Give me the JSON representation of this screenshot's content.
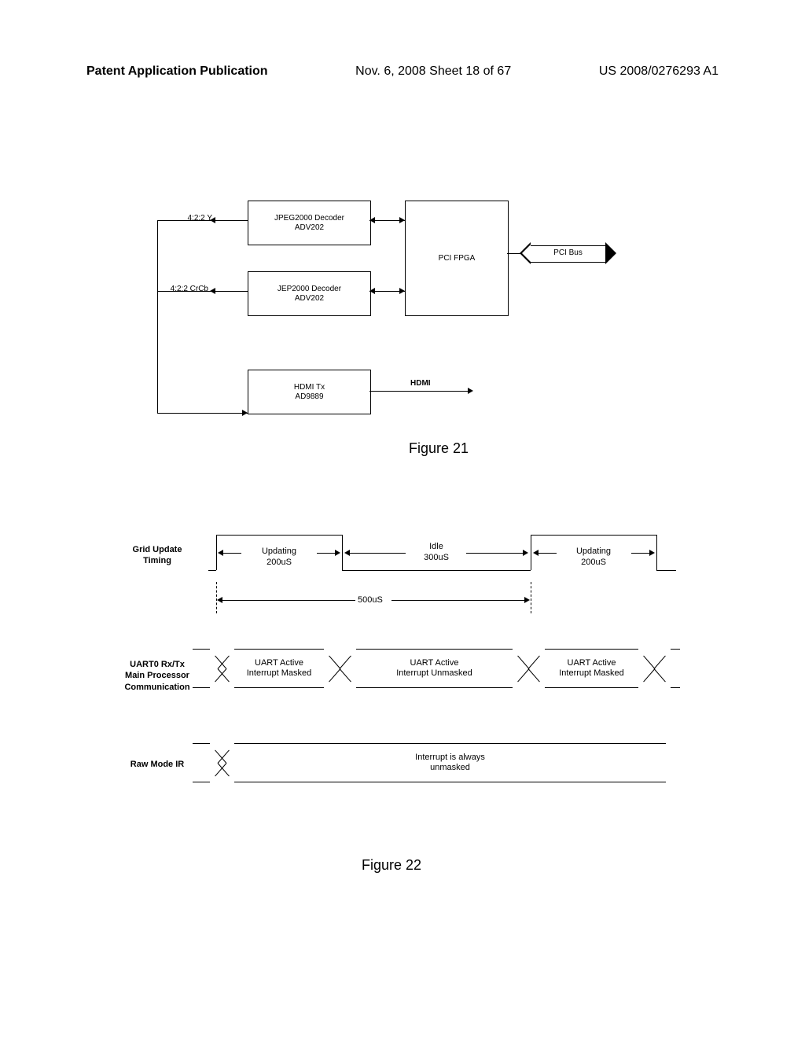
{
  "header": {
    "left": "Patent Application Publication",
    "center": "Nov. 6, 2008   Sheet 18 of 67",
    "right": "US 2008/0276293 A1"
  },
  "fig21": {
    "caption": "Figure 21",
    "labels": {
      "y": "4:2:2 Y",
      "crcb": "4:2:2 CrCb"
    },
    "boxes": {
      "decoder1_l1": "JPEG2000 Decoder",
      "decoder1_l2": "ADV202",
      "decoder2_l1": "JEP2000 Decoder",
      "decoder2_l2": "ADV202",
      "hdmitx_l1": "HDMI Tx",
      "hdmitx_l2": "AD9889",
      "fpga": "PCI FPGA",
      "hdmi_out": "HDMI",
      "pcibus": "PCI Bus"
    }
  },
  "fig22": {
    "caption": "Figure 22",
    "row1_label": "Grid Update\nTiming",
    "row2_label": "UART0 Rx/Tx\nMain Processor\nCommunication",
    "row3_label": "Raw Mode IR",
    "updating": "Updating\n200uS",
    "idle": "Idle\n300uS",
    "period": "500uS",
    "uart_masked": "UART Active\nInterrupt Masked",
    "uart_unmasked": "UART Active\nInterrupt Unmasked",
    "ir_text": "Interrupt is always\nunmasked"
  },
  "chart_data": {
    "type": "timing",
    "grid_update": {
      "period_us": 500,
      "phases": [
        {
          "state": "Updating",
          "duration_us": 200,
          "level": "high"
        },
        {
          "state": "Idle",
          "duration_us": 300,
          "level": "low"
        }
      ]
    },
    "uart0": {
      "segments": [
        {
          "label": "UART Active Interrupt Masked",
          "during": "Updating"
        },
        {
          "label": "UART Active Interrupt Unmasked",
          "during": "Idle"
        },
        {
          "label": "UART Active Interrupt Masked",
          "during": "Updating"
        }
      ]
    },
    "raw_mode_ir": {
      "label": "Interrupt is always unmasked",
      "continuous": true
    }
  }
}
